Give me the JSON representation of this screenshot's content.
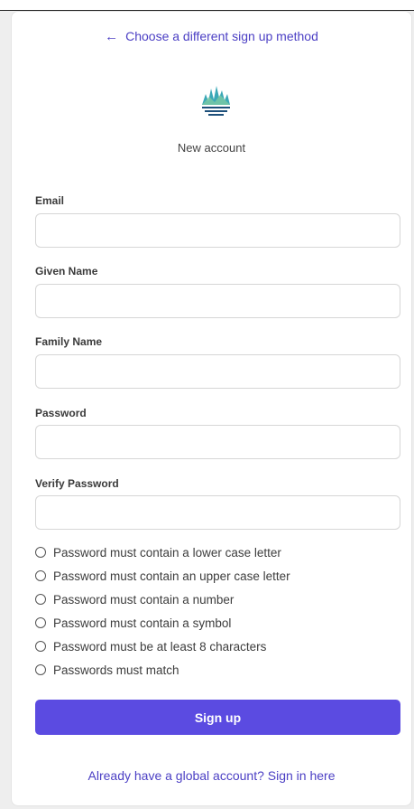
{
  "header": {
    "back_link": "Choose a different sign up method",
    "subtitle": "New account",
    "logo_icon": "energy-queensland-logo"
  },
  "form": {
    "email_label": "Email",
    "email_value": "",
    "given_name_label": "Given Name",
    "given_name_value": "",
    "family_name_label": "Family Name",
    "family_name_value": "",
    "password_label": "Password",
    "password_value": "",
    "verify_password_label": "Verify Password",
    "verify_password_value": ""
  },
  "rules": [
    "Password must contain a lower case letter",
    "Password must contain an upper case letter",
    "Password must contain a number",
    "Password must contain a symbol",
    "Password must be at least 8 characters",
    "Passwords must match"
  ],
  "actions": {
    "signup_label": "Sign up",
    "signin_link": "Already have a global account? Sign in here"
  },
  "colors": {
    "accent": "#5b4be1",
    "link": "#4b3fc4",
    "logo": "#3aa8b7"
  }
}
